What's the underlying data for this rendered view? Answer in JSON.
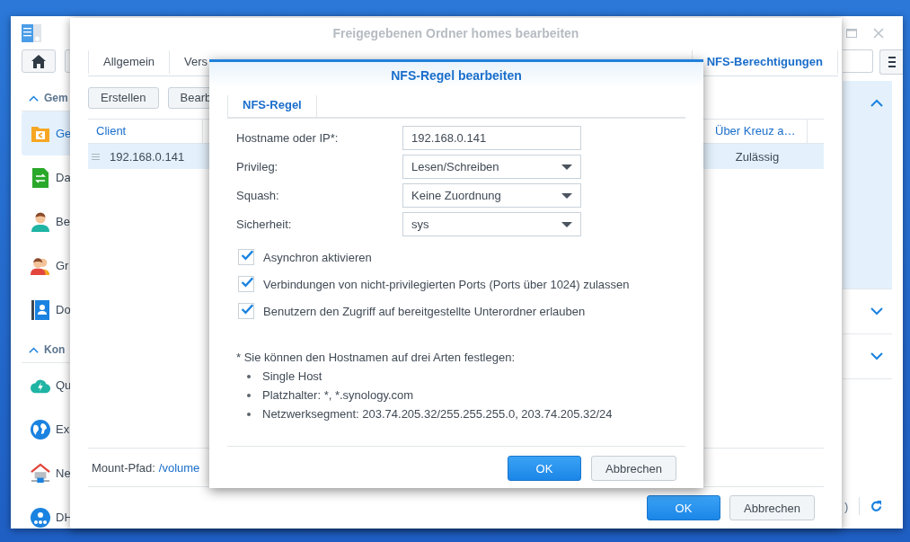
{
  "control_panel": {
    "sidebar_sections": [
      {
        "label": "Gem",
        "expanded": true,
        "items": [
          {
            "label": "Ge",
            "selected": true
          },
          {
            "label": "Da",
            "selected": false
          },
          {
            "label": "Be",
            "selected": false
          },
          {
            "label": "Gr",
            "selected": false
          },
          {
            "label": "Do",
            "selected": false
          }
        ]
      },
      {
        "label": "Kon",
        "expanded": true,
        "items": [
          {
            "label": "Qu",
            "selected": false
          },
          {
            "label": "Ex",
            "selected": false
          },
          {
            "label": "Ne",
            "selected": false
          },
          {
            "label": "DH",
            "selected": false
          }
        ]
      }
    ],
    "panels": [
      {
        "expanded": true
      },
      {
        "expanded": false
      },
      {
        "expanded": false
      }
    ],
    "status_text": ")"
  },
  "shared_folder_window": {
    "title": "Freigegebenen Ordner homes bearbeiten",
    "tabs": [
      {
        "label": "Allgemein",
        "selected": false
      },
      {
        "label": "Vers",
        "selected": false
      },
      {
        "label": "NFS-Berechtigungen",
        "selected": true
      }
    ],
    "toolbar": [
      "Erstellen",
      "Bearb"
    ],
    "table": {
      "columns": [
        "Client",
        "Über Kreuz a…"
      ],
      "rows": [
        {
          "cells": [
            "192.168.0.141",
            "Zulässig"
          ],
          "selected": true
        }
      ]
    },
    "mount_path": {
      "label": "Mount-Pfad:",
      "value": "/volume"
    },
    "buttons": [
      {
        "label": "OK",
        "primary": true
      },
      {
        "label": "Abbrechen",
        "primary": false
      }
    ]
  },
  "nfs_rule_dialog": {
    "title": "NFS-Regel bearbeiten",
    "tabs": [
      {
        "label": "NFS-Regel",
        "selected": true
      }
    ],
    "fields": [
      {
        "label": "Hostname oder IP*:",
        "kind": "text",
        "value": "192.168.0.141"
      },
      {
        "label": "Privileg:",
        "kind": "select",
        "value": "Lesen/Schreiben"
      },
      {
        "label": "Squash:",
        "kind": "select",
        "value": "Keine Zuordnung"
      },
      {
        "label": "Sicherheit:",
        "kind": "select",
        "value": "sys"
      }
    ],
    "checkboxes": [
      {
        "label": "Asynchron aktivieren",
        "checked": true
      },
      {
        "label": "Verbindungen von nicht-privilegierten Ports (Ports über 1024) zulassen",
        "checked": true
      },
      {
        "label": "Benutzern den Zugriff auf bereitgestellte Unterordner erlauben",
        "checked": true
      }
    ],
    "note": "* Sie können den Hostnamen auf drei Arten festlegen:",
    "bullets": [
      "Single Host",
      "Platzhalter: *, *.synology.com",
      "Netzwerksegment: 203.74.205.32/255.255.255.0, 203.74.205.32/24"
    ],
    "buttons": [
      {
        "label": "OK",
        "primary": true
      },
      {
        "label": "Abbrechen",
        "primary": false
      }
    ]
  }
}
